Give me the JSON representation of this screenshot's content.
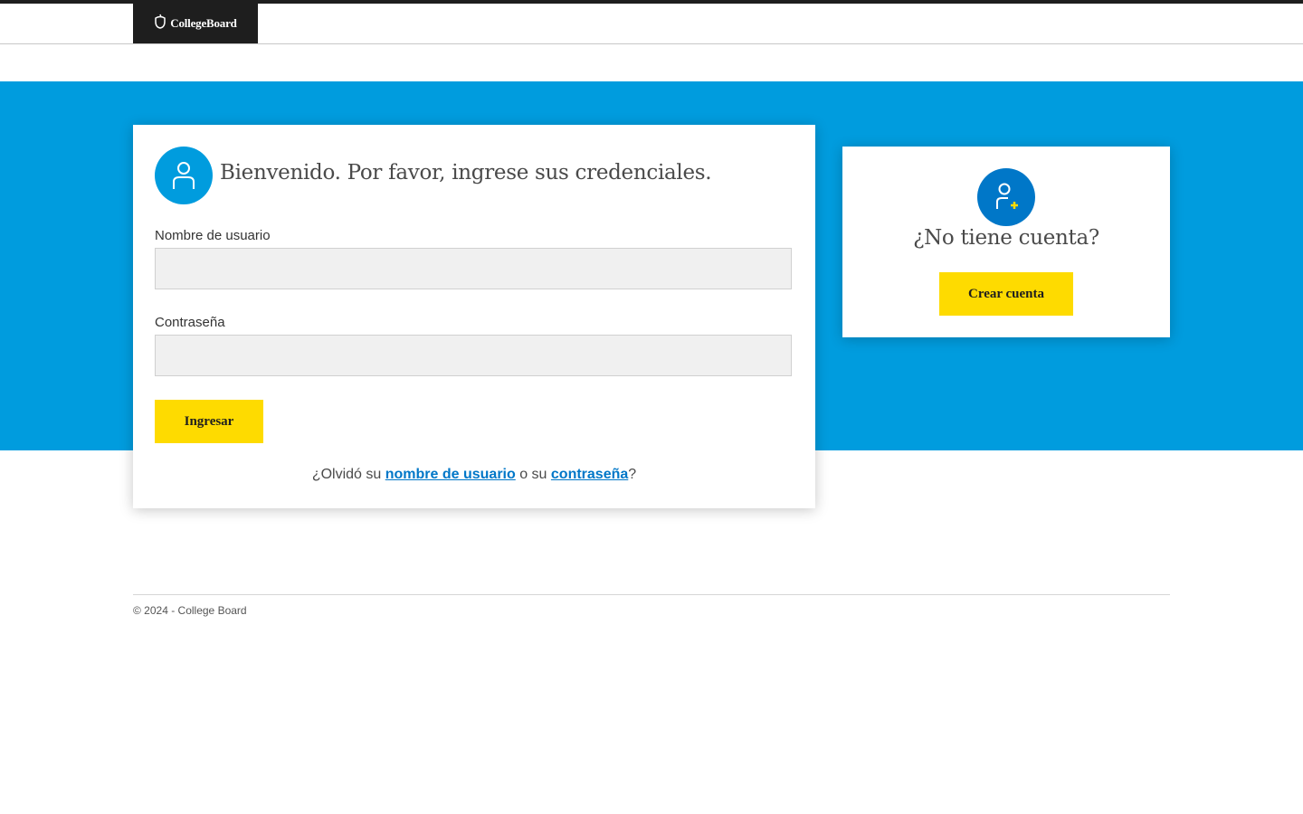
{
  "header": {
    "logo_text": "CollegeBoard",
    "logo_icon": "acorn-icon"
  },
  "login": {
    "avatar_icon": "user-icon",
    "title": "Bienvenido. Por favor, ingrese sus credenciales.",
    "username_label": "Nombre de usuario",
    "username_value": "",
    "password_label": "Contraseña",
    "password_value": "",
    "submit_label": "Ingresar",
    "forgot_prefix": "¿Olvidó su ",
    "forgot_username_link": "nombre de usuario",
    "forgot_middle": " o su ",
    "forgot_password_link": "contraseña",
    "forgot_suffix": "?"
  },
  "signup": {
    "avatar_icon": "user-add-icon",
    "title": "¿No tiene cuenta?",
    "button_label": "Crear cuenta"
  },
  "footer": {
    "copyright": "© 2024 - College Board"
  },
  "colors": {
    "band": "#009cde",
    "accent_yellow": "#fedb00",
    "link": "#0077c8",
    "dark": "#1e1e1e"
  }
}
